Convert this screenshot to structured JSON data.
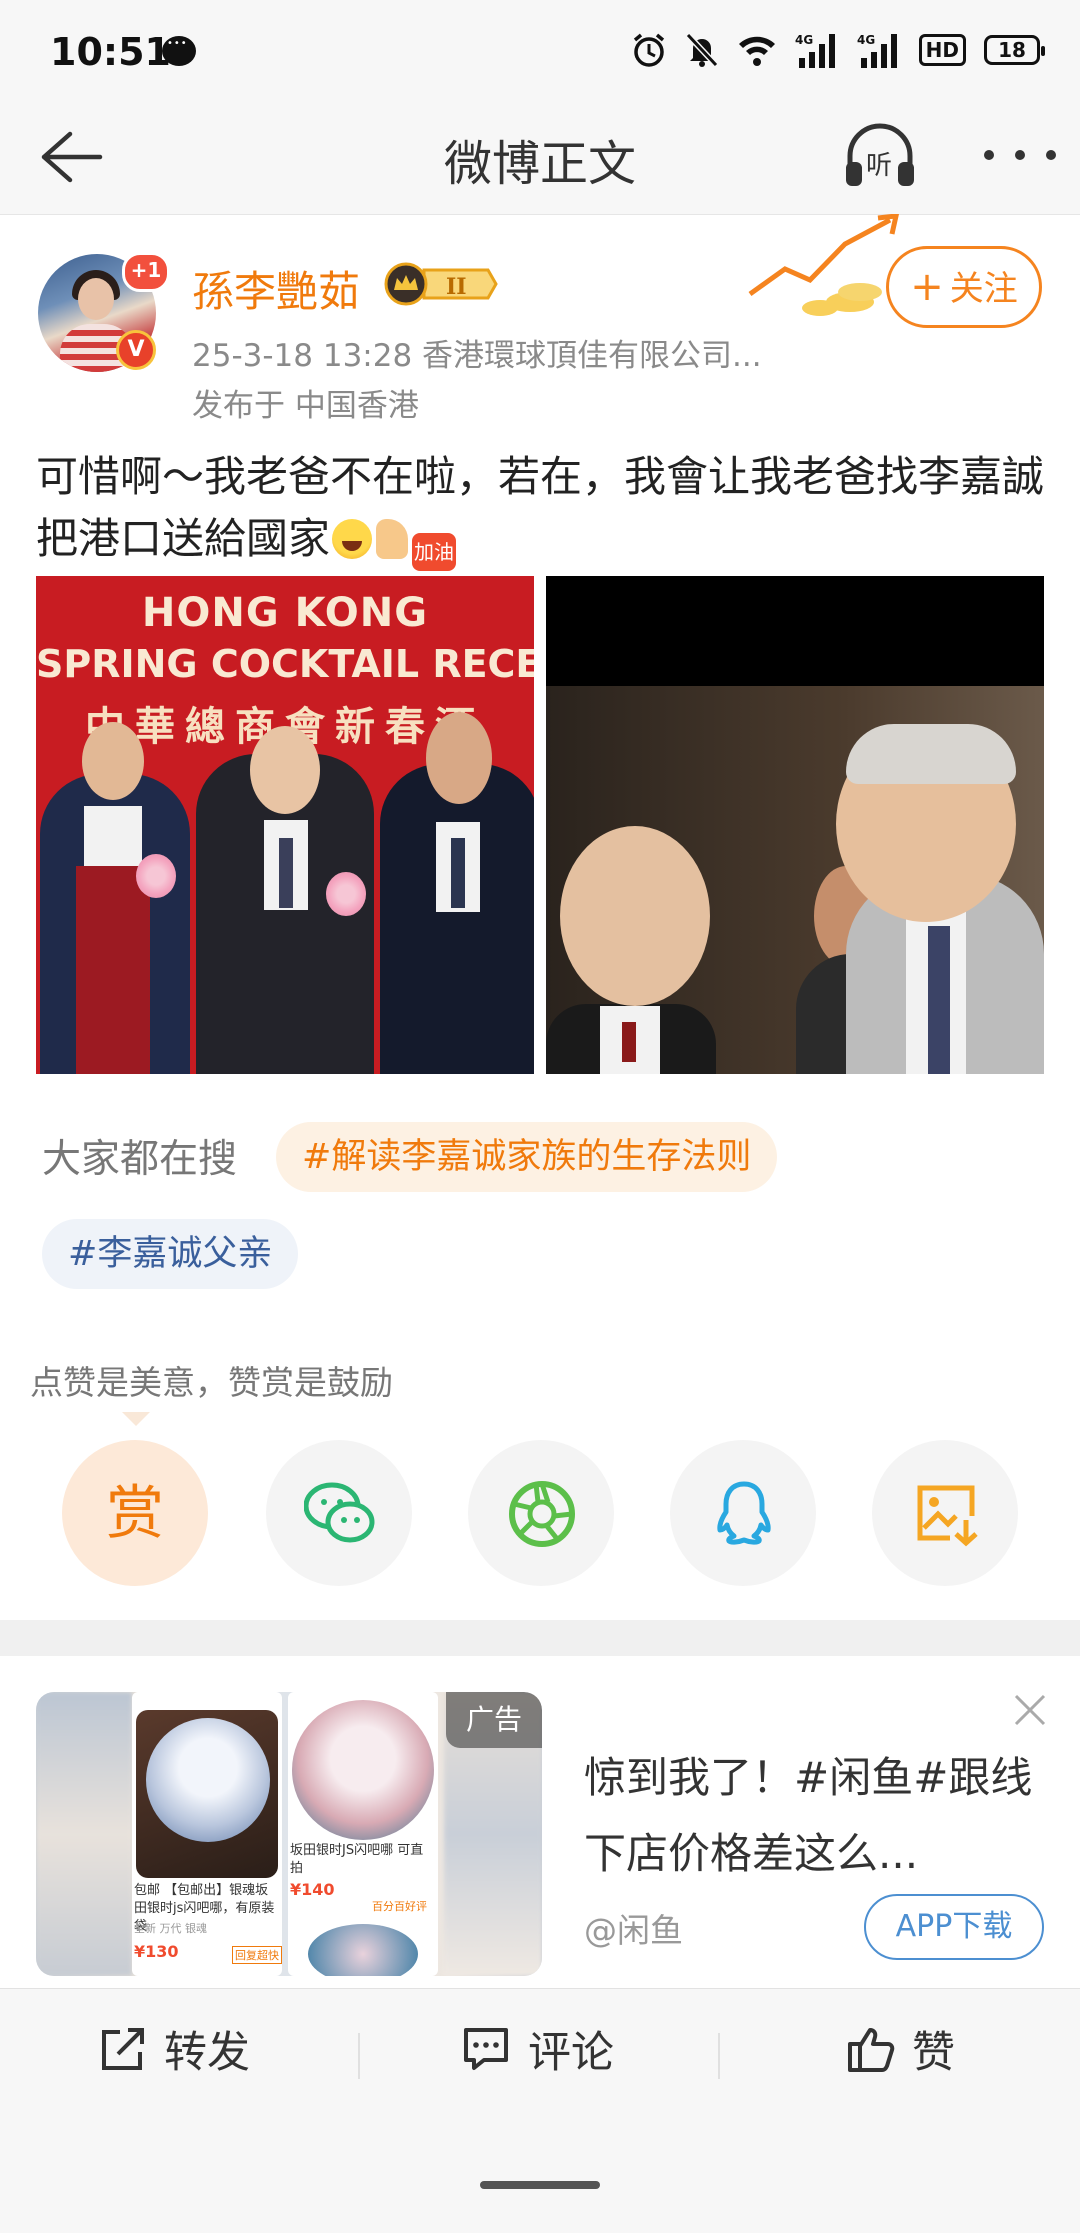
{
  "status_bar": {
    "time": "10:51",
    "hd_label": "HD",
    "battery": "18"
  },
  "nav": {
    "title": "微博正文",
    "listen_label": "听"
  },
  "post": {
    "username": "孫李艷茹",
    "level_badge": "II",
    "follower_badge": "+1",
    "verified_mark": "V",
    "meta": "25-3-18 13:28  香港環球頂佳有限公司...",
    "location": "发布于 中国香港",
    "follow_label": "关注",
    "text": "可惜啊～我老爸不在啦，若在，我會让我老爸找李嘉誠把港口送給國家",
    "emoji_cheer": "加油",
    "photo1_banner": {
      "line1": "HONG KONG",
      "line2": "SPRING COCKTAIL RECEPTIO",
      "line3": "中華總商會新春酒"
    }
  },
  "search": {
    "label": "大家都在搜",
    "tags": [
      "#解读李嘉诚家族的生存法则",
      "#李嘉诚父亲"
    ]
  },
  "reward": {
    "hint": "点赞是美意，赞赏是鼓励",
    "reward_label": "赏"
  },
  "ad": {
    "tag": "广告",
    "text": "惊到我了！#闲鱼#跟线下店价格差这么...",
    "source": "@闲鱼",
    "button": "APP下载",
    "card_texts": [
      "坂田银时JS闪吧哪 可直拍",
      "包邮 【包邮出】银魂坂田银时js闪吧哪，有原装袋",
      "全新  万代  银魂",
      "¥130",
      "¥140",
      "百分百好评",
      "回复超快"
    ]
  },
  "bottom_bar": {
    "repost": "转发",
    "comment": "评论",
    "like": "赞"
  },
  "colors": {
    "accent_orange": "#f07a0c",
    "tag_blue": "#3a5f9c",
    "ad_blue": "#4c8fd1"
  }
}
